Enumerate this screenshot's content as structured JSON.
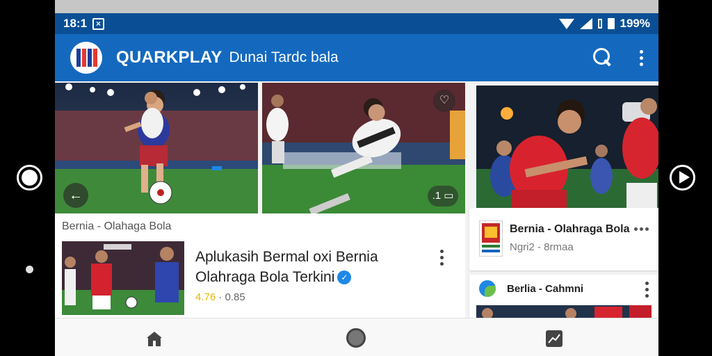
{
  "status_bar": {
    "time": "18:1",
    "notification_icon": "x-box-icon",
    "battery": "199%"
  },
  "appbar": {
    "app_name": "QUARKPLAY",
    "subtitle": "Dunai Tardc bala",
    "logo_icon": "flag-logo-icon",
    "search_icon": "search-icon",
    "menu_icon": "more-vert-icon"
  },
  "gallery": {
    "back_button_icon": "arrow-left-icon",
    "image2_badge": ".1",
    "image2_badge_icon": "bookmark-icon"
  },
  "featured": {
    "section_label": "Bernia - Olahaga Bola",
    "title": "Aplukasih Bermal oxi Bernia Olahraga Bola Terkini",
    "rating": "4.76",
    "meta_extra": "0.85",
    "verified_icon": "verified-check-icon"
  },
  "side_list": [
    {
      "title": "Bernia - Olahraga Bola",
      "meta": "Ngri2 - 8rmaa"
    },
    {
      "title": "Berlia - Cahmni"
    }
  ],
  "colors": {
    "status_bar": "#0a4f95",
    "appbar": "#1469bf",
    "accent": "#1e88e5"
  }
}
